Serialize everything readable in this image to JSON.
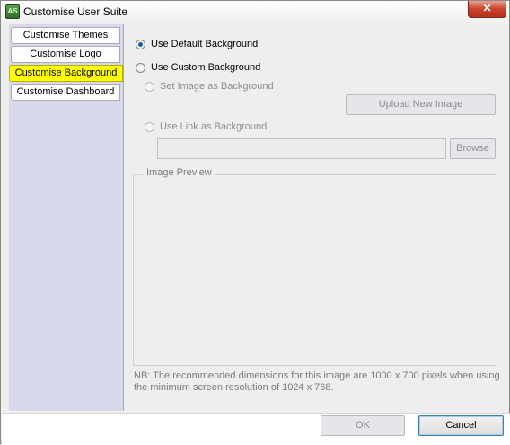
{
  "window": {
    "title": "Customise User Suite",
    "app_icon_text": "AS"
  },
  "sidebar": {
    "tabs": [
      {
        "label": "Customise Themes"
      },
      {
        "label": "Customise Logo"
      },
      {
        "label": "Customise Background"
      },
      {
        "label": "Customise Dashboard"
      }
    ],
    "active_tab": "Customise Background"
  },
  "content": {
    "default_bg_label": "Use Default Background",
    "custom_bg_label": "Use Custom Background",
    "set_image_label": "Set Image as Background",
    "upload_button": "Upload New Image",
    "use_link_label": "Use Link as Background",
    "link_value": "",
    "browse_button": "Browse",
    "preview_title": "Image Preview",
    "note": "NB: The recommended dimensions for this image are 1000 x 700 pixels when using the minimum screen resolution of 1024 x 768."
  },
  "footer": {
    "ok_label": "OK",
    "cancel_label": "Cancel"
  },
  "colors": {
    "active_tab": "#ffff00",
    "sidebar": "#d7d9ea",
    "close": "#c9432f"
  }
}
